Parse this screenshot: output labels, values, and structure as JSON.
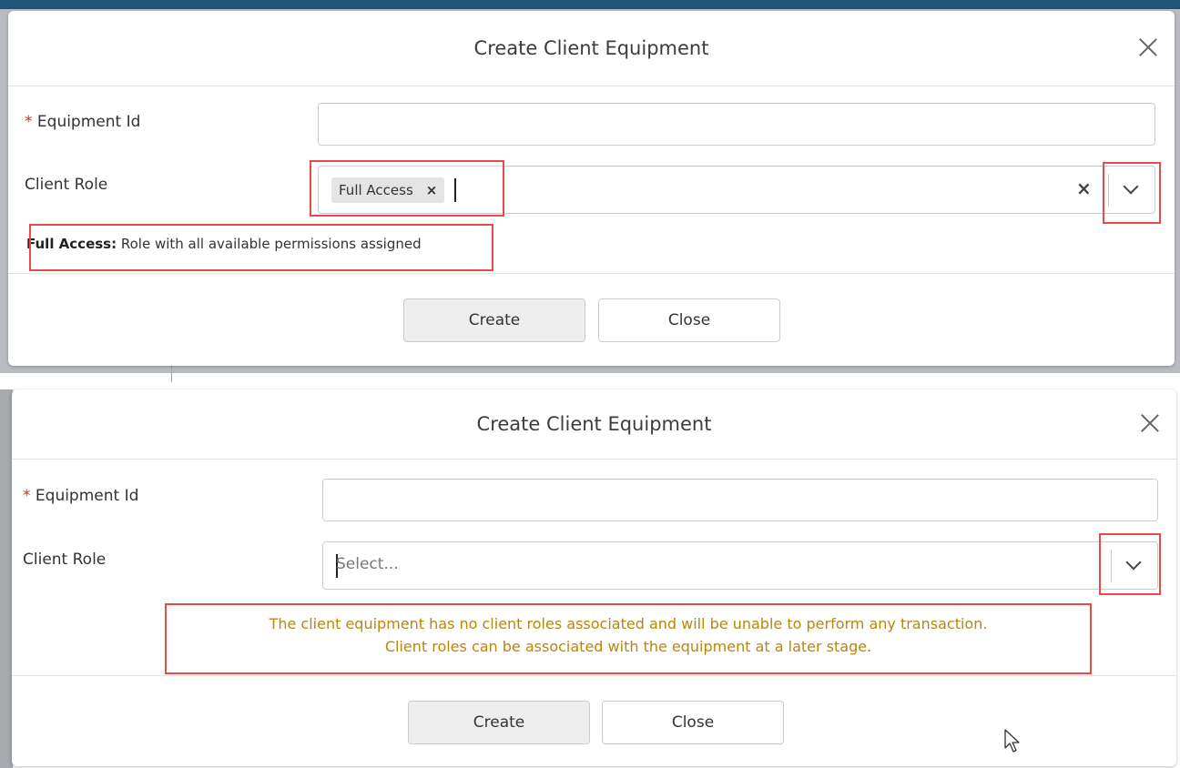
{
  "dialogs": [
    {
      "title": "Create Client Equipment",
      "required_marker": "*",
      "equipment_id_label": "Equipment Id",
      "client_role_label": "Client Role",
      "selected_chip": "Full Access",
      "chip_remove_glyph": "×",
      "clear_glyph": "×",
      "help_name": "Full Access:",
      "help_text": " Role with all available permissions assigned",
      "create_label": "Create",
      "close_label": "Close"
    },
    {
      "title": "Create Client Equipment",
      "required_marker": "*",
      "equipment_id_label": "Equipment Id",
      "client_role_label": "Client Role",
      "select_placeholder": "Select...",
      "warning_line1": "The client equipment has no client roles associated and will be unable to perform any transaction.",
      "warning_line2": "Client roles can be associated with the equipment at a later stage.",
      "create_label": "Create",
      "close_label": "Close"
    }
  ],
  "colors": {
    "highlight": "#e84a4a",
    "warning_text": "#b8860b",
    "required": "#c0392b",
    "topbar": "#1d5577"
  },
  "icons": [
    "close-icon",
    "chevron-down-icon",
    "clear-icon",
    "mouse-pointer-icon"
  ]
}
